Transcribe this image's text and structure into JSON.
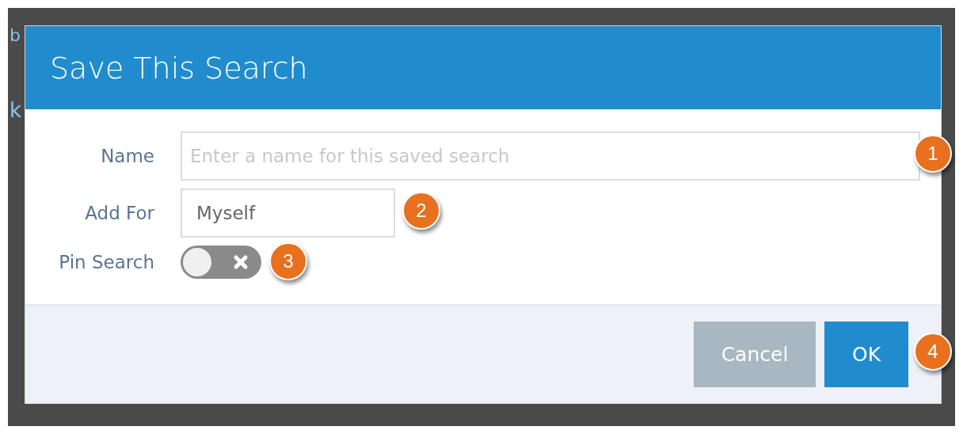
{
  "background": {
    "fragments": [
      "b",
      "k"
    ]
  },
  "dialog": {
    "title": "Save This Search",
    "fields": [
      {
        "kind": "text",
        "label": "Name",
        "placeholder": "Enter a name for this saved search"
      },
      {
        "kind": "select",
        "label": "Add For",
        "value": "Myself"
      },
      {
        "kind": "toggle",
        "label": "Pin Search",
        "on": false
      }
    ],
    "buttons": [
      {
        "label": "Cancel",
        "kind": "secondary"
      },
      {
        "label": "OK",
        "kind": "primary"
      }
    ]
  },
  "callouts": [
    "1",
    "2",
    "3",
    "4"
  ]
}
